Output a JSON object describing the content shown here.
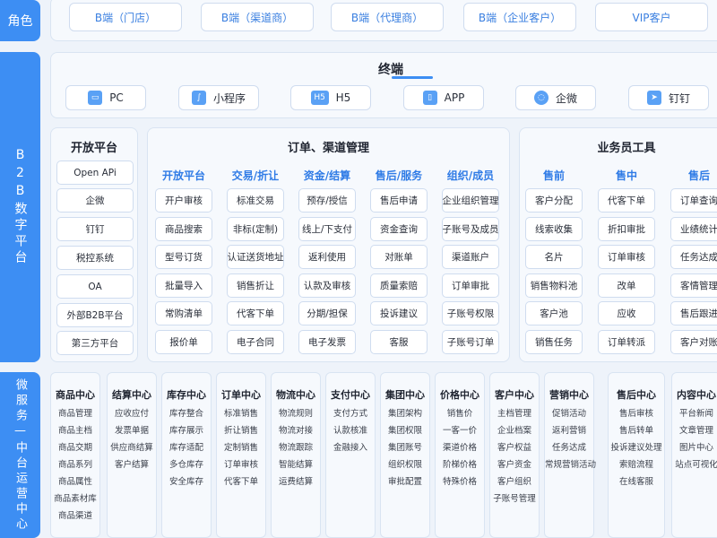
{
  "roles": {
    "label": "角色",
    "items": [
      "B端（门店）",
      "B端（渠道商）",
      "B端（代理商）",
      "B端（企业客户）",
      "VIP客户"
    ]
  },
  "b2b_label": "B2B数字平台",
  "terminal": {
    "title": "终端",
    "items": [
      {
        "label": "PC",
        "icon": "monitor-icon"
      },
      {
        "label": "小程序",
        "icon": "mini-program-icon"
      },
      {
        "label": "H5",
        "icon": "h5-icon"
      },
      {
        "label": "APP",
        "icon": "phone-icon"
      },
      {
        "label": "企微",
        "icon": "wecom-icon"
      },
      {
        "label": "钉钉",
        "icon": "dingtalk-icon"
      }
    ]
  },
  "open_platform": {
    "title": "开放平台",
    "items": [
      "Open APi",
      "企微",
      "钉钉",
      "税控系统",
      "OA",
      "外部B2B平台",
      "第三方平台"
    ]
  },
  "order_mgmt": {
    "title": "订单、渠道管理",
    "columns": [
      {
        "head": "开放平台",
        "items": [
          "开户审核",
          "商品搜索",
          "型号订货",
          "批量导入",
          "常购清单",
          "报价单"
        ]
      },
      {
        "head": "交易/折让",
        "items": [
          "标准交易",
          "非标(定制)",
          "认证送货地址",
          "销售折让",
          "代客下单",
          "电子合同"
        ]
      },
      {
        "head": "资金/结算",
        "items": [
          "预存/授信",
          "线上/下支付",
          "返利使用",
          "认款及审核",
          "分期/担保",
          "电子发票"
        ]
      },
      {
        "head": "售后/服务",
        "items": [
          "售后申请",
          "资金查询",
          "对账单",
          "质量索赔",
          "投诉建议",
          "客服"
        ]
      },
      {
        "head": "组织/成员",
        "items": [
          "企业组织管理",
          "子账号及成员",
          "渠道账户",
          "订单审批",
          "子账号权限",
          "子账号订单"
        ]
      }
    ]
  },
  "sales_tools": {
    "title": "业务员工具",
    "columns": [
      {
        "head": "售前",
        "items": [
          "客户分配",
          "线索收集",
          "名片",
          "销售物料池",
          "客户池",
          "销售任务"
        ]
      },
      {
        "head": "售中",
        "items": [
          "代客下单",
          "折扣审批",
          "订单审核",
          "改单",
          "应收",
          "订单转派"
        ]
      },
      {
        "head": "售后",
        "items": [
          "订单查询",
          "业绩统计",
          "任务达成",
          "客情管理",
          "售后跟进",
          "客户对账"
        ]
      }
    ]
  },
  "micro_label": "微服务—中台运营中心",
  "micro_services": [
    {
      "title": "商品中心",
      "items": [
        "商品管理",
        "商品主档",
        "商品交期",
        "商品系列",
        "商品属性",
        "商品素材库",
        "商品渠道"
      ]
    },
    {
      "title": "结算中心",
      "items": [
        "应收应付",
        "发票单据",
        "供应商结算",
        "客户结算"
      ]
    },
    {
      "title": "库存中心",
      "items": [
        "库存整合",
        "库存展示",
        "库存适配",
        "多仓库存",
        "安全库存"
      ]
    },
    {
      "title": "订单中心",
      "items": [
        "标准销售",
        "折让销售",
        "定制销售",
        "订单审核",
        "代客下单"
      ]
    },
    {
      "title": "物流中心",
      "items": [
        "物流规则",
        "物流对接",
        "物流跟踪",
        "智能结算",
        "运费结算"
      ]
    },
    {
      "title": "支付中心",
      "items": [
        "支付方式",
        "认款核准",
        "金融接入"
      ]
    },
    {
      "title": "集团中心",
      "items": [
        "集团架构",
        "集团权限",
        "集团账号",
        "组织权限",
        "审批配置"
      ]
    },
    {
      "title": "价格中心",
      "items": [
        "销售价",
        "一客一价",
        "渠道价格",
        "阶梯价格",
        "特殊价格"
      ]
    },
    {
      "title": "客户中心",
      "items": [
        "主档管理",
        "企业档案",
        "客户权益",
        "客户资金",
        "客户组织",
        "子账号管理"
      ]
    },
    {
      "title": "营销中心",
      "items": [
        "促销活动",
        "返利营销",
        "任务达成",
        "常规营销活动"
      ]
    },
    {
      "title": "售后中心",
      "items": [
        "售后审核",
        "售后转单",
        "投诉建议处理",
        "索赔流程",
        "在线客服"
      ]
    },
    {
      "title": "内容中心",
      "items": [
        "平台新闻",
        "文章管理",
        "图片中心",
        "站点可视化"
      ]
    }
  ]
}
